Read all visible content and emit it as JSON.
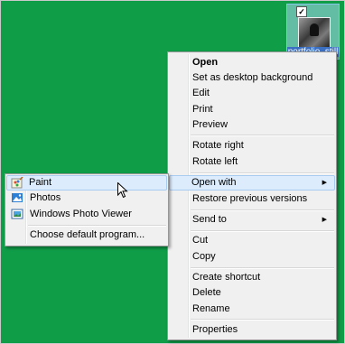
{
  "desktop": {
    "background": "#0f9d48",
    "file": {
      "name": "portfolio_still",
      "checked": true
    }
  },
  "context_menu": {
    "items": [
      {
        "label": "Open"
      },
      {
        "label": "Set as desktop background"
      },
      {
        "label": "Edit"
      },
      {
        "label": "Print"
      },
      {
        "label": "Preview"
      },
      {
        "label": "Rotate right"
      },
      {
        "label": "Rotate left"
      },
      {
        "label": "Open with"
      },
      {
        "label": "Restore previous versions"
      },
      {
        "label": "Send to"
      },
      {
        "label": "Cut"
      },
      {
        "label": "Copy"
      },
      {
        "label": "Create shortcut"
      },
      {
        "label": "Delete"
      },
      {
        "label": "Rename"
      },
      {
        "label": "Properties"
      }
    ]
  },
  "open_with_submenu": {
    "items": [
      {
        "label": "Paint",
        "icon": "paint-icon"
      },
      {
        "label": "Photos",
        "icon": "photos-icon"
      },
      {
        "label": "Windows Photo Viewer",
        "icon": "photo-viewer-icon"
      },
      {
        "label": "Choose default program..."
      }
    ]
  },
  "colors": {
    "highlight": "#dcecfc",
    "highlight_border": "#a8cbf0",
    "menu_bg": "#f0f0f0"
  }
}
